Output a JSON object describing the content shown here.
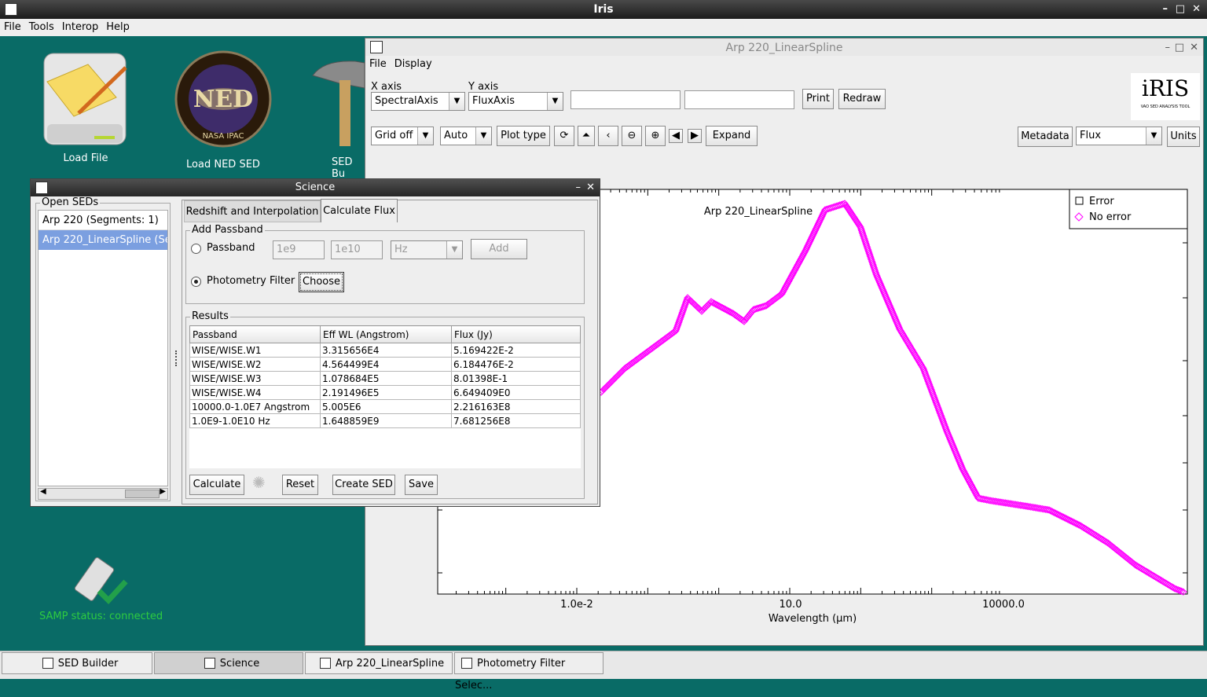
{
  "main_window": {
    "title": "Iris",
    "menu": [
      "File",
      "Tools",
      "Interop",
      "Help"
    ]
  },
  "desktop": {
    "icons": [
      {
        "label": "Load File"
      },
      {
        "label": "Load NED SED",
        "badge": "NED",
        "badge_sub": "NASA IPAC"
      },
      {
        "label": "SED Bu"
      }
    ],
    "samp_status": "SAMP status: connected"
  },
  "plot_window": {
    "title": "Arp 220_LinearSpline",
    "menu": [
      "File",
      "Display"
    ],
    "x_axis_label": "X axis",
    "x_axis_value": "SpectralAxis",
    "y_axis_label": "Y axis",
    "y_axis_value": "FluxAxis",
    "print_label": "Print",
    "redraw_label": "Redraw",
    "logo_text": "iRIS",
    "logo_sub": "VAO SED ANALYSIS TOOL",
    "grid_value": "Grid off",
    "scale_value": "Auto",
    "plot_type_label": "Plot type",
    "expand_label": "Expand",
    "metadata_label": "Metadata",
    "flux_value": "Flux",
    "units_label": "Units",
    "plot_title": "Arp 220_LinearSpline",
    "legend": [
      {
        "label": "Error",
        "color": "#000000"
      },
      {
        "label": "No error",
        "color": "#ff00ff"
      }
    ],
    "x_ticks": [
      "1.0e-2",
      "10.0",
      "10000.0"
    ],
    "xlabel": "Wavelength (µm)",
    "series_color": "#ff00ff"
  },
  "science_window": {
    "title": "Science",
    "open_seds_label": "Open SEDs",
    "seds": [
      "Arp 220 (Segments: 1)",
      "Arp 220_LinearSpline (Se"
    ],
    "tabs": [
      "Redshift and Interpolation",
      "Calculate Flux"
    ],
    "add_passband_label": "Add Passband",
    "passband_label": "Passband",
    "passband_min": "1e9",
    "passband_max": "1e10",
    "passband_unit": "Hz",
    "add_label": "Add",
    "photometry_filter_label": "Photometry Filter",
    "choose_label": "Choose",
    "results_label": "Results",
    "columns": [
      "Passband",
      "Eff WL (Angstrom)",
      "Flux (Jy)"
    ],
    "rows": [
      [
        "WISE/WISE.W1",
        "3.315656E4",
        "5.169422E-2"
      ],
      [
        "WISE/WISE.W2",
        "4.564499E4",
        "6.184476E-2"
      ],
      [
        "WISE/WISE.W3",
        "1.078684E5",
        "8.01398E-1"
      ],
      [
        "WISE/WISE.W4",
        "2.191496E5",
        "6.649409E0"
      ],
      [
        "10000.0-1.0E7 Angstrom",
        "5.005E6",
        "2.216163E8"
      ],
      [
        "1.0E9-1.0E10 Hz",
        "1.648859E9",
        "7.681256E8"
      ]
    ],
    "calculate_label": "Calculate",
    "reset_label": "Reset",
    "create_sed_label": "Create SED",
    "save_label": "Save"
  },
  "taskbar": [
    "SED Builder",
    "Science",
    "Arp 220_LinearSpline",
    "Photometry Filter Selec..."
  ]
}
